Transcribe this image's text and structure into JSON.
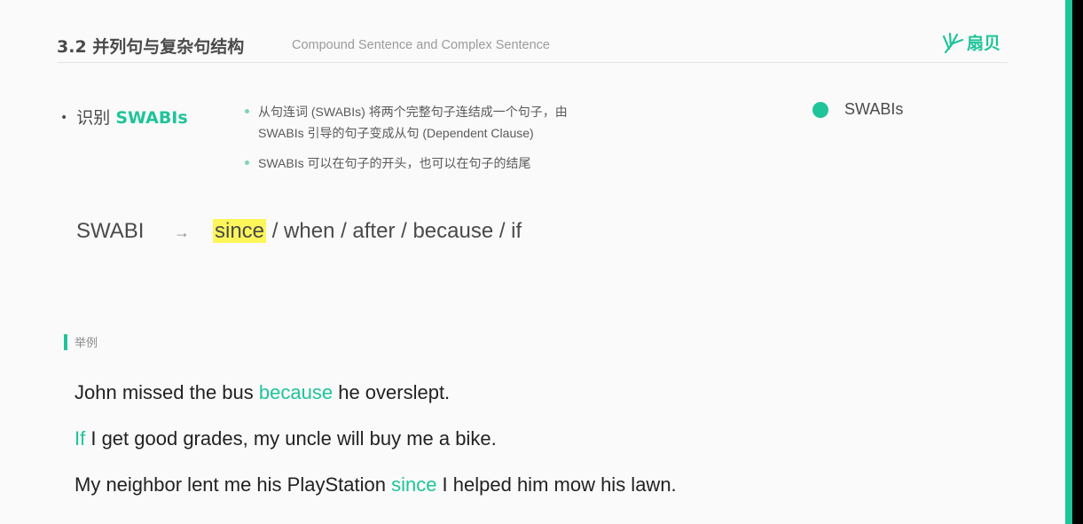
{
  "header": {
    "title": "3.2 并列句与复杂句结构",
    "subtitle": "Compound Sentence and Complex Sentence",
    "logo_text": "扇贝",
    "logo_icon": "leaf-sprout-icon"
  },
  "bullet": {
    "label": "识别",
    "keyword": "SWABIs"
  },
  "sub_points": [
    "从句连词 (SWABIs) 将两个完整句子连结成一个句子，由 SWABIs 引导的句子变成从句 (Dependent Clause)",
    "SWABIs 可以在句子的开头，也可以在句子的结尾"
  ],
  "legend": {
    "label": "SWABIs",
    "color": "#1fc49a"
  },
  "swabi_row": {
    "label": "SWABI",
    "arrow": "→",
    "highlighted": "since",
    "rest": " / when / after / because / if"
  },
  "example": {
    "tag": "举例",
    "sentences": [
      {
        "before": "John missed the bus ",
        "keyword": "because",
        "after": " he overslept."
      },
      {
        "before": "",
        "keyword": "If",
        "after": " I get good grades, my uncle will buy me a bike."
      },
      {
        "before": "My neighbor lent me his PlayStation ",
        "keyword": "since",
        "after": " I helped him mow his lawn."
      }
    ]
  },
  "colors": {
    "accent": "#1fc49a",
    "highlight": "#fcf65a"
  }
}
